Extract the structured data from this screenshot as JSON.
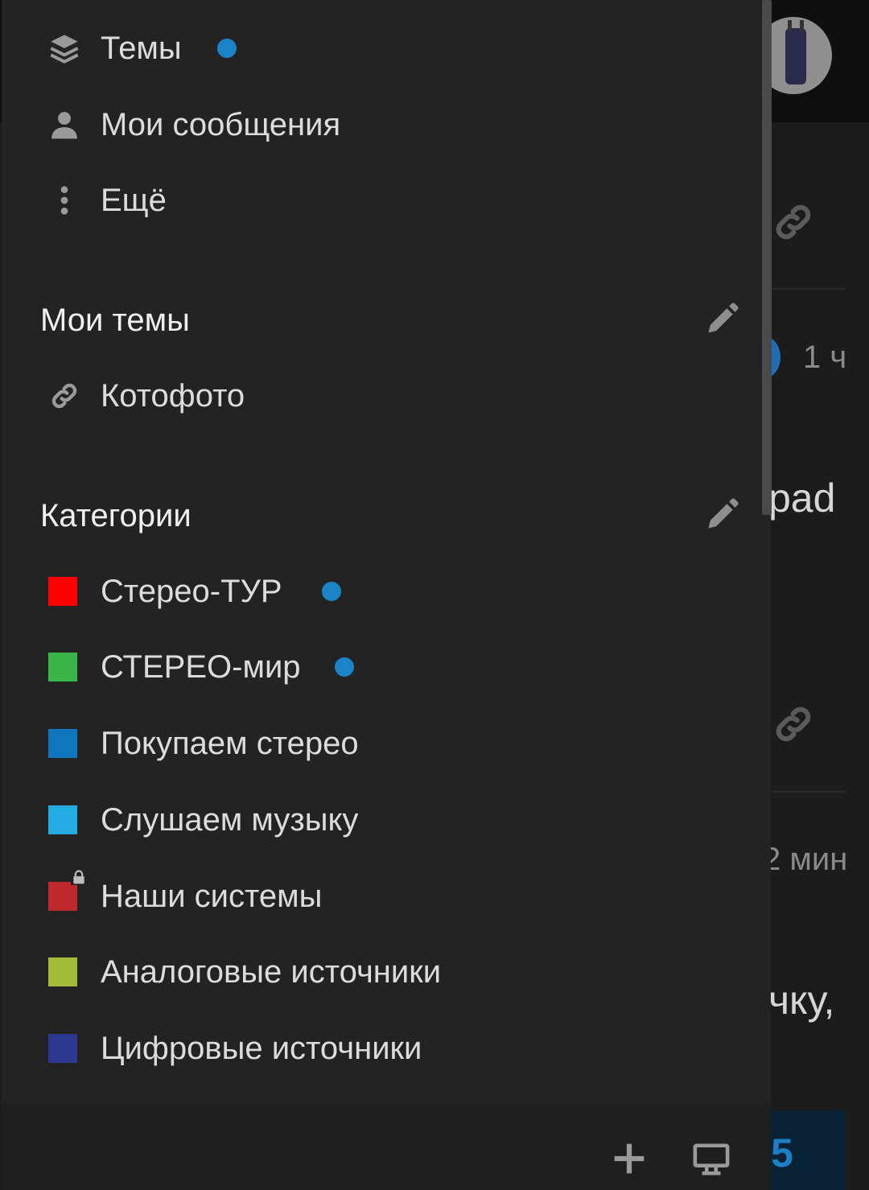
{
  "background": {
    "time_1": "1 ч",
    "snippet_1": "pad",
    "time_2": "2 мин",
    "snippet_2": "чку,",
    "count": "5"
  },
  "sidebar": {
    "nav": [
      {
        "label": "Темы",
        "icon": "layers-icon",
        "unread": true
      },
      {
        "label": "Мои сообщения",
        "icon": "user-icon",
        "unread": false
      },
      {
        "label": "Ещё",
        "icon": "more-vertical-icon",
        "unread": false
      }
    ],
    "my_topics": {
      "title": "Мои темы",
      "items": [
        {
          "label": "Котофото",
          "icon": "link-icon"
        }
      ]
    },
    "categories": {
      "title": "Категории",
      "items": [
        {
          "label": "Стерео-ТУР",
          "color": "#ff0000",
          "unread": true,
          "locked": false
        },
        {
          "label": "СТЕРЕО-мир",
          "color": "#3ab54a",
          "unread": true,
          "locked": false
        },
        {
          "label": "Покупаем стерео",
          "color": "#0e76bd",
          "unread": false,
          "locked": false
        },
        {
          "label": "Слушаем музыку",
          "color": "#25aae1",
          "unread": false,
          "locked": false
        },
        {
          "label": "Наши системы",
          "color": "#c0282d",
          "unread": false,
          "locked": true
        },
        {
          "label": "Аналоговые источники",
          "color": "#a4bc3a",
          "unread": false,
          "locked": false
        },
        {
          "label": "Цифровые источники",
          "color": "#2b3990",
          "unread": false,
          "locked": false
        }
      ]
    },
    "footer": {
      "add_icon": "plus-icon",
      "desktop_icon": "desktop-icon"
    }
  },
  "colors": {
    "sidebar_bg": "#232323",
    "unread_dot": "#1b84c6",
    "text": "#dcdcdc"
  }
}
